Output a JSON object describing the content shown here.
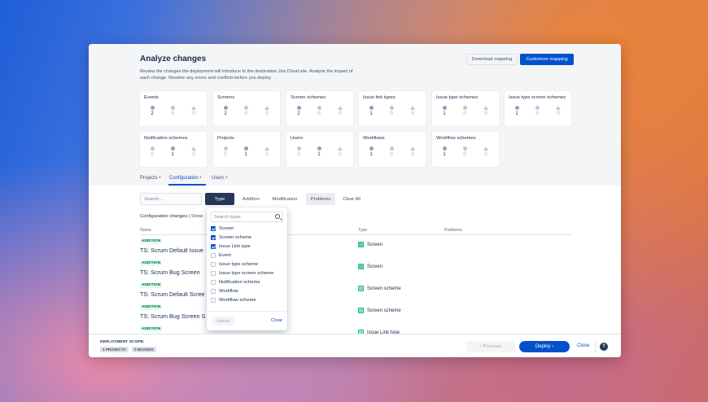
{
  "header": {
    "title": "Analyze changes",
    "description": "Review the changes the deployment will introduce to the destination Jira Cloud site. Analyze the impact of each change. Resolve any errors and conflicts before you deploy.",
    "download_mapping": "Download mapping",
    "customize_mapping": "Customize mapping"
  },
  "cards": [
    {
      "label": "Events",
      "values": [
        "2",
        "0",
        "0"
      ]
    },
    {
      "label": "Screens",
      "values": [
        "2",
        "0",
        "0"
      ]
    },
    {
      "label": "Screen schemes",
      "values": [
        "2",
        "0",
        "0"
      ]
    },
    {
      "label": "Issue link types",
      "values": [
        "1",
        "0",
        "0"
      ]
    },
    {
      "label": "Issue type schemes",
      "values": [
        "1",
        "0",
        "0"
      ]
    },
    {
      "label": "Issue type screen schemes",
      "values": [
        "1",
        "0",
        "0"
      ]
    },
    {
      "label": "Notification schemes",
      "values": [
        "0",
        "1",
        "0"
      ]
    },
    {
      "label": "Projects",
      "values": [
        "0",
        "1",
        "0"
      ]
    },
    {
      "label": "Users",
      "values": [
        "0",
        "1",
        "0"
      ]
    },
    {
      "label": "Workflows",
      "values": [
        "1",
        "0",
        "0"
      ]
    },
    {
      "label": "Workflow schemes",
      "values": [
        "1",
        "0",
        "0"
      ]
    }
  ],
  "tabs": [
    {
      "label": "Projects"
    },
    {
      "label": "Configuration"
    },
    {
      "label": "Users"
    }
  ],
  "filters": {
    "search_placeholder": "Search...",
    "type": "Type",
    "addition": "Addition",
    "modification": "Modification",
    "problems": "Problems",
    "clear_all": "Clear All"
  },
  "table": {
    "section_title": "Configuration changes",
    "section_sub": " | Show",
    "columns": {
      "name": "Name",
      "type": "Type",
      "problems": "Problems"
    },
    "rows": [
      {
        "badge": "ADDITION",
        "name": "TS: Scrum Default Issue Screen",
        "type": "Screen"
      },
      {
        "badge": "ADDITION",
        "name": "TS: Scrum Bug Screen",
        "type": "Screen"
      },
      {
        "badge": "ADDITION",
        "name": "TS: Scrum Default Screen Scheme",
        "type": "Screen scheme"
      },
      {
        "badge": "ADDITION",
        "name": "TS: Scrum Bug Screen Scheme",
        "type": "Screen scheme"
      },
      {
        "badge": "ADDITION",
        "name": "",
        "type": "Issue Link type"
      }
    ]
  },
  "dropdown": {
    "search_placeholder": "Search types",
    "items": [
      {
        "label": "Screen",
        "checked": true
      },
      {
        "label": "Screen scheme",
        "checked": true
      },
      {
        "label": "Issue Link type",
        "checked": true
      },
      {
        "label": "Event",
        "checked": false
      },
      {
        "label": "Issue type scheme",
        "checked": false
      },
      {
        "label": "Issue type screen scheme",
        "checked": false
      },
      {
        "label": "Notification scheme",
        "checked": false
      },
      {
        "label": "Workflow",
        "checked": false
      },
      {
        "label": "Workflow scheme",
        "checked": false
      }
    ],
    "update": "Update",
    "clear": "Clear"
  },
  "footer": {
    "scope_label": "DEPLOYMENT SCOPE:",
    "projects_pill": "1 PROJECTS",
    "boards_pill": "0 BOARDS",
    "previous": "Previous",
    "deploy": "Deploy",
    "close": "Close",
    "help": "?"
  }
}
